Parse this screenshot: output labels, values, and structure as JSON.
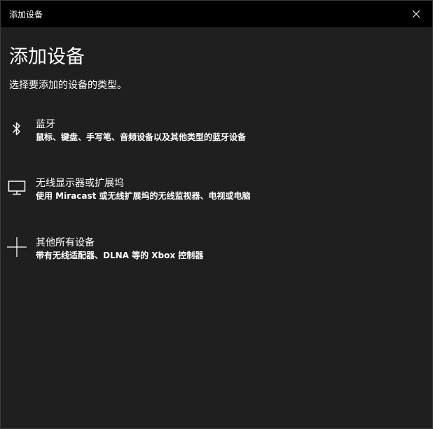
{
  "window": {
    "title": "添加设备",
    "close_icon": "close-icon"
  },
  "main": {
    "heading": "添加设备",
    "subtitle": "选择要添加的设备的类型。",
    "options": [
      {
        "title": "蓝牙",
        "description": "鼠标、键盘、手写笔、音频设备以及其他类型的蓝牙设备",
        "icon": "bluetooth-icon"
      },
      {
        "title": "无线显示器或扩展坞",
        "description": "使用 Miracast 或无线扩展坞的无线监视器、电视或电脑",
        "icon": "monitor-icon"
      },
      {
        "title": "其他所有设备",
        "description": "带有无线适配器、DLNA 等的 Xbox 控制器",
        "icon": "plus-icon"
      }
    ]
  },
  "colors": {
    "titlebar": "#000000",
    "background": "#1f1f1f",
    "text": "#ffffff"
  }
}
